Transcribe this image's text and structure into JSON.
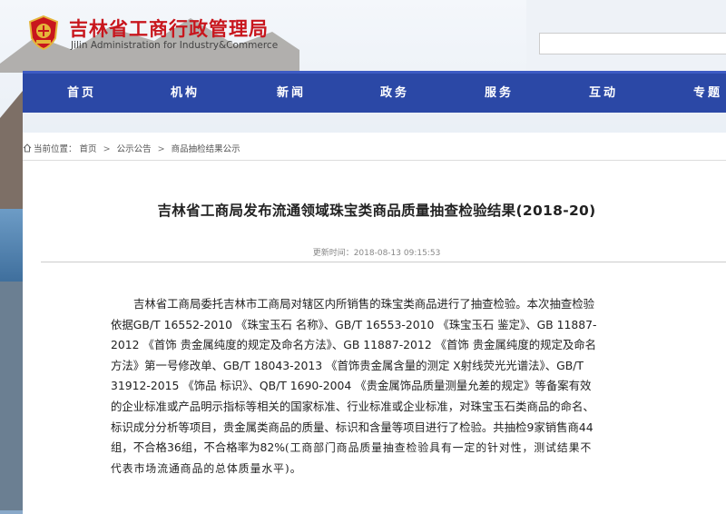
{
  "header": {
    "title": "吉林省工商行政管理局",
    "subtitle": "Jilin Administration for Industry&Commerce",
    "top_links": [
      "",
      ""
    ]
  },
  "nav": {
    "items": [
      {
        "label": "首页"
      },
      {
        "label": "机构"
      },
      {
        "label": "新闻"
      },
      {
        "label": "政务"
      },
      {
        "label": "服务"
      },
      {
        "label": "互动"
      },
      {
        "label": "专题"
      }
    ]
  },
  "breadcrumb": {
    "prefix": "当前位置：",
    "items": [
      "首页",
      "公示公告",
      "商品抽检结果公示"
    ],
    "separator": ">"
  },
  "article": {
    "title": "吉林省工商局发布流通领域珠宝类商品质量抽查检验结果(2018-20)",
    "updated": "更新时间：2018-08-13 09:15:53",
    "lines": [
      "吉林省工商局委托吉林市工商局对辖区内所销售的珠宝类商品进行了抽查检验。本次抽查检验",
      "依据GB/T 16552-2010 《珠宝玉石 名称》、GB/T 16553-2010 《珠宝玉石 鉴定》、GB 11887-",
      "2012 《首饰 贵金属纯度的规定及命名方法》、GB 11887-2012 《首饰 贵金属纯度的规定及命名",
      "方法》第一号修改单、GB/T 18043-2013 《首饰贵金属含量的测定  X射线荧光光谱法》、GB/T",
      "31912-2015 《饰品 标识》、QB/T 1690-2004 《贵金属饰品质量测量允差的规定》等备案有效",
      "的企业标准或产品明示指标等相关的国家标准、行业标准或企业标准，对珠宝玉石类商品的命名、",
      "标识成分分析等项目，贵金属类商品的质量、标识和含量等项目进行了检验。共抽检9家销售商44",
      "组，不合格36组，不合格率为82%",
      "(工商部门商品质量抽查检验具有一定的针对性，测试结果不",
      "代表市场流通商品的总体质量水平)",
      "。"
    ]
  },
  "colors": {
    "brand_red": "#c8161d",
    "nav_blue": "#2b48a6"
  },
  "icons": {
    "emblem": "state-emblem-icon",
    "home": "home-icon"
  }
}
